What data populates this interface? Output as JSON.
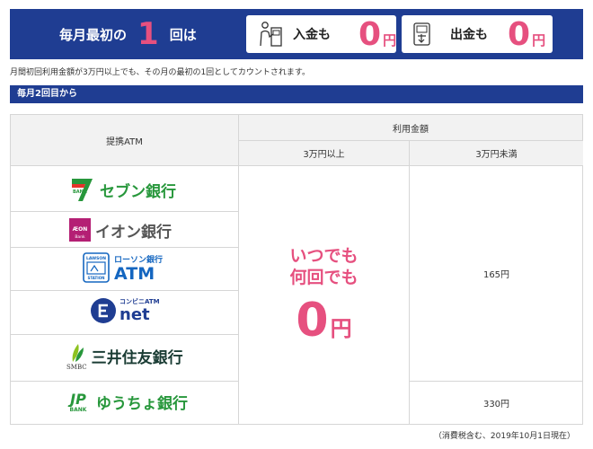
{
  "banner": {
    "lead_prefix": "毎月最初の",
    "lead_count": "1",
    "lead_suffix": "回は",
    "deposit_label": "入金も",
    "withdraw_label": "出金も",
    "zero_value": "0",
    "zero_unit": "円",
    "deposit_icon": "atm-deposit-icon",
    "withdraw_icon": "atm-withdraw-icon"
  },
  "note": "月間初回利用金額が3万円以上でも、その月の最初の1回としてカウントされます。",
  "section_title": "毎月2回目から",
  "table": {
    "col_atm": "提携ATM",
    "col_amount": "利用金額",
    "col_over": "3万円以上",
    "col_under": "3万円未満",
    "banks": [
      {
        "name": "セブン銀行",
        "icon": "seven-bank-logo"
      },
      {
        "name": "イオン銀行",
        "icon": "aeon-bank-logo",
        "sub": "ÆON",
        "sub2": "Bank"
      },
      {
        "name": "ATM",
        "icon": "lawson-station-logo",
        "top": "ローソン銀行",
        "badge": "LAWSON STATION"
      },
      {
        "name": "net",
        "icon": "enet-logo",
        "top": "コンビニATM"
      },
      {
        "name": "三井住友銀行",
        "icon": "smbc-logo",
        "sub": "SMBC"
      },
      {
        "name": "ゆうちょ銀行",
        "icon": "jp-bank-logo",
        "sub": "BANK"
      }
    ],
    "free_line1": "いつでも",
    "free_line2": "何回でも",
    "free_value": "0",
    "free_unit": "円",
    "fee_under_1": "165円",
    "fee_under_2": "330円"
  },
  "footnote": "（消費税含む、2019年10月1日現在）",
  "colors": {
    "navy": "#1f3d92",
    "pink": "#e6507f",
    "green": "#27973b",
    "aeon": "#b41f74",
    "lawson": "#1466c0"
  }
}
